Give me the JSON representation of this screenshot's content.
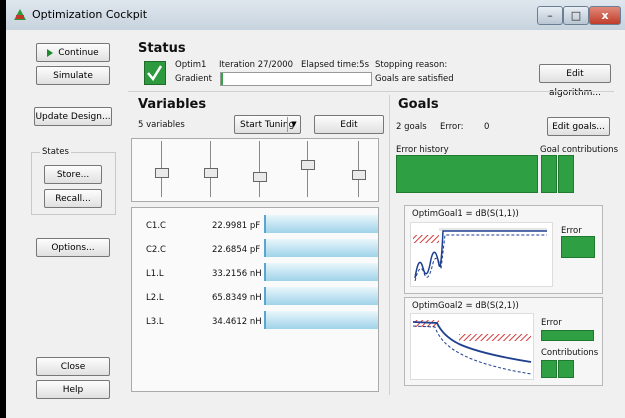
{
  "window": {
    "title": "Optimization Cockpit",
    "min": "–",
    "max": "□",
    "close": "x"
  },
  "left_buttons": {
    "continue": "Continue",
    "simulate": "Simulate",
    "update_design": "Update Design...",
    "states_label": "States",
    "store": "Store...",
    "recall": "Recall...",
    "options": "Options...",
    "close": "Close",
    "help": "Help"
  },
  "status": {
    "heading": "Status",
    "optimizer_name": "Optim1",
    "method": "Gradient",
    "iteration": "Iteration 27/2000",
    "elapsed": "Elapsed time:5s",
    "stopping_label": "Stopping reason:",
    "stopping_value": "Goals are satisfied",
    "edit_algorithm": "Edit algorithm...",
    "progress": 0.0135
  },
  "variables": {
    "heading": "Variables",
    "count": "5 variables",
    "start_tuning": "Start Tuning",
    "edit_variables": "Edit variables...",
    "items": [
      {
        "name": "C1.C",
        "value": "22.9981 pF"
      },
      {
        "name": "C2.C",
        "value": "22.6854 pF"
      },
      {
        "name": "L1.L",
        "value": "33.2156 nH"
      },
      {
        "name": "L2.L",
        "value": "65.8349 nH"
      },
      {
        "name": "L3.L",
        "value": "34.4612 nH"
      }
    ],
    "slider_levels": [
      0.45,
      0.45,
      0.38,
      0.62,
      0.42
    ]
  },
  "goals": {
    "heading": "Goals",
    "count": "2 goals",
    "error_label": "Error:",
    "error_value": "0",
    "edit_goals": "Edit goals...",
    "error_history": "Error history",
    "goal_contributions": "Goal contributions",
    "goal1": {
      "title": "OptimGoal1 = dB(S(1,1))",
      "error_label": "Error"
    },
    "goal2": {
      "title": "OptimGoal2 = dB(S(2,1))",
      "error_label": "Error",
      "contributions_label": "Contributions"
    }
  },
  "colors": {
    "green": "#33a44a",
    "accent_blue": "#5aa6cf",
    "hatch_red": "#d23c3c",
    "curve_blue": "#1f3f8f"
  }
}
